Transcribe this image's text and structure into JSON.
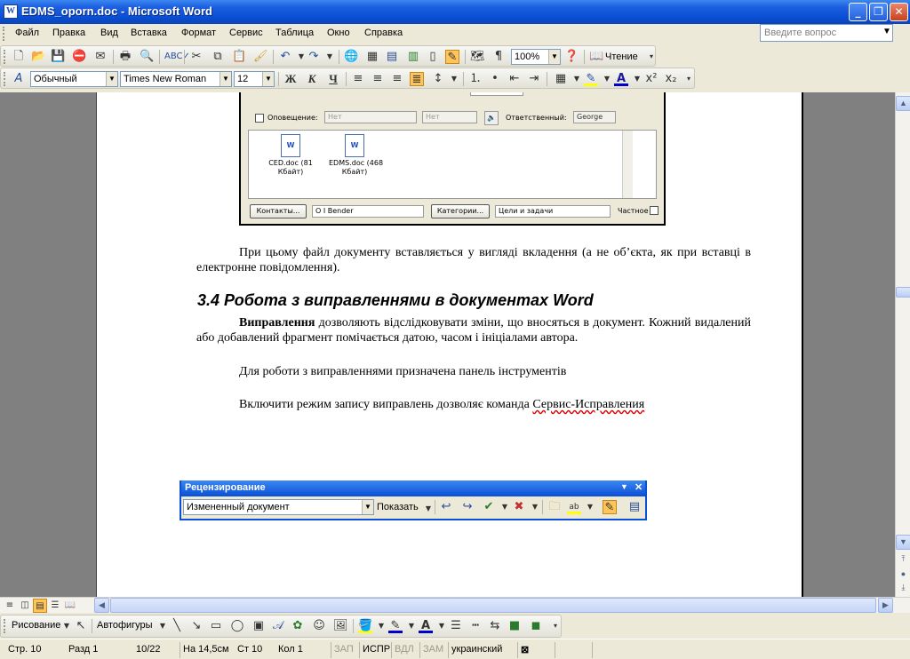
{
  "titlebar": {
    "title": "EDMS_oporn.doc - Microsoft Word",
    "icon": "W"
  },
  "menubar": {
    "items": [
      "Файл",
      "Правка",
      "Вид",
      "Вставка",
      "Формат",
      "Сервис",
      "Таблица",
      "Окно",
      "Справка"
    ],
    "ask_placeholder": "Введите вопрос"
  },
  "standard_toolbar": {
    "zoom": "100%",
    "reading_label": "Чтение"
  },
  "format_toolbar": {
    "style": "Обычный",
    "font": "Times New Roman",
    "size": "12"
  },
  "embedded_dialog": {
    "notify_label": "Оповещение:",
    "notify_value": "Нет",
    "notify_value2": "Нет",
    "responsible_label": "Ответственный:",
    "responsible_value": "George",
    "files": [
      {
        "name": "CED.doc (81",
        "size": "Кбайт)"
      },
      {
        "name": "EDMS.doc (468",
        "size": "Кбайт)"
      }
    ],
    "contacts_button": "Контакты...",
    "contacts_value": "O I Bender",
    "categories_button": "Категории...",
    "categories_value": "Цели и задачи",
    "private_label": "Частное"
  },
  "document": {
    "para1": "При цьому файл документу вставляється у вигляді вкладення (а не об’єкта, як при вставці в електронне повідомлення).",
    "heading": "3.4  Робота з виправленнями в документах Word",
    "para2_bold": "Виправлення",
    "para2_rest": " дозволяють відслідковувати зміни, що вносяться в документ. Кожний видалений або добавлений фрагмент помічається датою, часом і ініціалами автора.",
    "para3": "Для роботи з виправленнями призначена панель інструментів",
    "para4_start": "Включити режим запису виправлень дозволяє команда ",
    "para4_link": "Сервис-Исправления "
  },
  "review_toolbar": {
    "title": "Рецензирование",
    "display_mode": "Измененный документ",
    "show_label": "Показать"
  },
  "drawing_toolbar": {
    "draw_label": "Рисование",
    "autoshapes_label": "Автофигуры"
  },
  "statusbar": {
    "page": "Стр. 10",
    "section": "Разд 1",
    "pages": "10/22",
    "at": "На 14,5см",
    "line": "Ст 10",
    "col": "Кол 1",
    "rec": "ЗАП",
    "trk": "ИСПР",
    "ext": "ВДЛ",
    "ovr": "ЗАМ",
    "language": "украинский"
  }
}
